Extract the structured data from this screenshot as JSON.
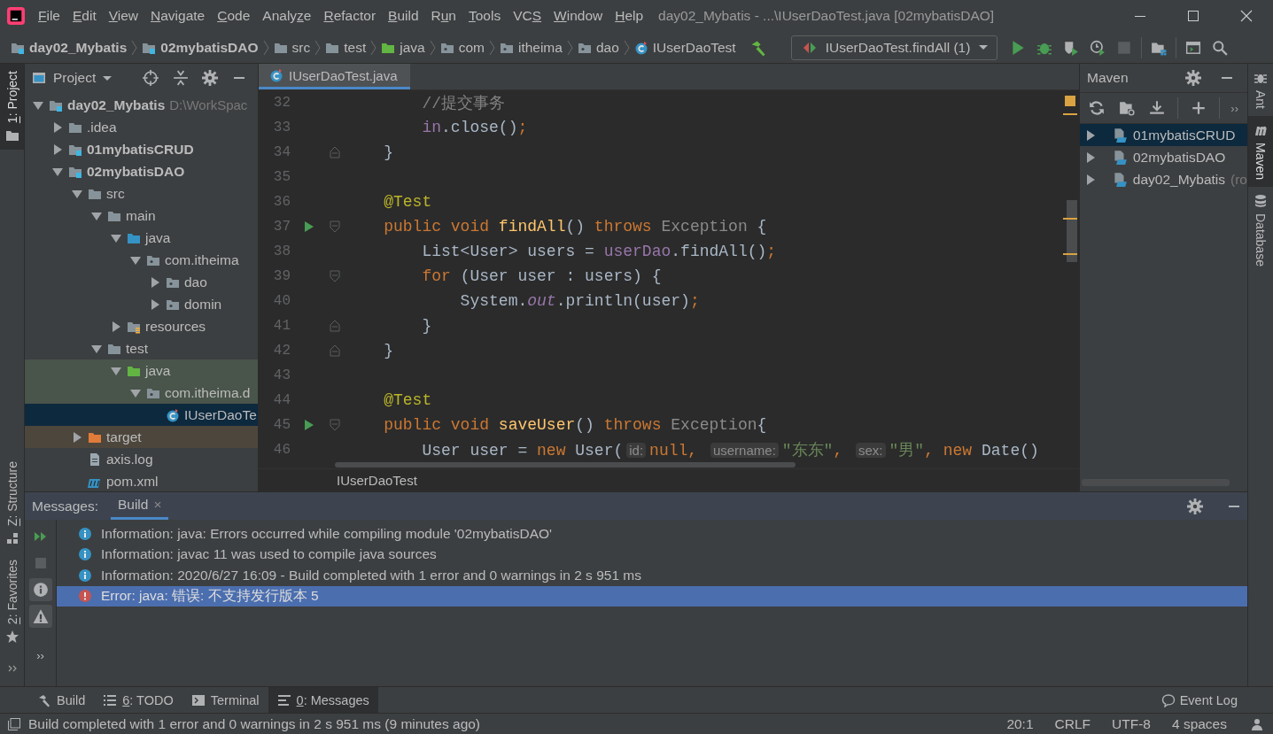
{
  "window": {
    "menus": [
      {
        "key": "F",
        "post": "ile"
      },
      {
        "key": "E",
        "post": "dit"
      },
      {
        "key": "V",
        "post": "iew"
      },
      {
        "key": "N",
        "post": "avigate"
      },
      {
        "key": "C",
        "post": "ode"
      },
      {
        "pre": "Analy",
        "key": "z",
        "post": "e"
      },
      {
        "key": "R",
        "post": "efactor"
      },
      {
        "key": "B",
        "post": "uild"
      },
      {
        "pre": "R",
        "key": "u",
        "post": "n"
      },
      {
        "key": "T",
        "post": "ools"
      },
      {
        "pre": "VC",
        "key": "S"
      },
      {
        "key": "W",
        "post": "indow"
      },
      {
        "key": "H",
        "post": "elp"
      }
    ],
    "title": "day02_Mybatis - ...\\IUserDaoTest.java [02mybatisDAO]"
  },
  "breadcrumbs": [
    {
      "label": "day02_Mybatis",
      "kind": "module",
      "bold": true
    },
    {
      "label": "02mybatisDAO",
      "kind": "module",
      "bold": true
    },
    {
      "label": "src",
      "kind": "folder",
      "bold": false
    },
    {
      "label": "test",
      "kind": "folder",
      "bold": false
    },
    {
      "label": "java",
      "kind": "test-folder",
      "bold": false
    },
    {
      "label": "com",
      "kind": "package",
      "bold": false
    },
    {
      "label": "itheima",
      "kind": "package",
      "bold": false
    },
    {
      "label": "dao",
      "kind": "package",
      "bold": false
    },
    {
      "label": "IUserDaoTest",
      "kind": "class",
      "bold": false
    }
  ],
  "run_config": {
    "label": "IUserDaoTest.findAll (1)"
  },
  "left_stripe": {
    "top": [
      {
        "key": "1",
        "post": ": Project",
        "selected": true
      }
    ],
    "bottom": [
      {
        "key": "Z",
        "post": ": Structure",
        "selected": false
      },
      {
        "key": "2",
        "post": ": Favorites",
        "selected": false
      }
    ]
  },
  "project": {
    "title": "Project",
    "tree": [
      {
        "label": "day02_Mybatis",
        "kind": "module",
        "bold": true,
        "path": "D:\\WorkSpac",
        "expanded": true,
        "selected": false,
        "children": [
          {
            "label": ".idea",
            "kind": "folder",
            "bold": false,
            "expanded": false,
            "selected": false
          },
          {
            "label": "01mybatisCRUD",
            "kind": "module",
            "bold": true,
            "expanded": false,
            "selected": false
          },
          {
            "label": "02mybatisDAO",
            "kind": "module",
            "bold": true,
            "expanded": true,
            "selected": false,
            "children": [
              {
                "label": "src",
                "kind": "folder",
                "bold": false,
                "expanded": true,
                "selected": false,
                "children": [
                  {
                    "label": "main",
                    "kind": "folder",
                    "bold": false,
                    "expanded": true,
                    "selected": false,
                    "children": [
                      {
                        "label": "java",
                        "kind": "source-folder",
                        "bold": false,
                        "expanded": true,
                        "selected": false,
                        "children": [
                          {
                            "label": "com.itheima",
                            "kind": "package",
                            "bold": false,
                            "expanded": true,
                            "selected": false,
                            "children": [
                              {
                                "label": "dao",
                                "kind": "package",
                                "bold": false,
                                "expanded": false,
                                "selected": false
                              },
                              {
                                "label": "domin",
                                "kind": "package",
                                "bold": false,
                                "expanded": false,
                                "selected": false
                              }
                            ]
                          }
                        ]
                      },
                      {
                        "label": "resources",
                        "kind": "resources",
                        "bold": false,
                        "expanded": false,
                        "selected": false
                      }
                    ]
                  },
                  {
                    "label": "test",
                    "kind": "folder",
                    "bold": false,
                    "expanded": true,
                    "selected": false,
                    "children": [
                      {
                        "label": "java",
                        "kind": "test-folder",
                        "bold": false,
                        "expanded": true,
                        "selected": false,
                        "color": "#49544a",
                        "children": [
                          {
                            "label": "com.itheima.d",
                            "kind": "package",
                            "bold": false,
                            "expanded": true,
                            "selected": false,
                            "color": "#49544a",
                            "children": [
                              {
                                "label": "IUserDaoTe",
                                "kind": "class",
                                "bold": false,
                                "selected": true
                              }
                            ]
                          }
                        ]
                      }
                    ]
                  }
                ]
              },
              {
                "label": "target",
                "kind": "excluded",
                "bold": false,
                "expanded": false,
                "selected": false,
                "color": "#4d463c"
              },
              {
                "label": "axis.log",
                "kind": "log",
                "bold": false,
                "selected": false
              },
              {
                "label": "pom.xml",
                "kind": "maven",
                "bold": false,
                "selected": false
              }
            ]
          }
        ]
      }
    ]
  },
  "editor": {
    "tab": {
      "label": "IUserDaoTest.java",
      "selected": true
    },
    "lines": [
      {
        "number": "32",
        "kind": "plain",
        "run": false,
        "tokens": [
          {
            "text": "        //提交事务",
            "kind": "comment"
          }
        ]
      },
      {
        "number": "33",
        "kind": "plain",
        "run": false,
        "tokens": [
          {
            "text": "        in",
            "kind": "field"
          },
          {
            "text": ".close()",
            "kind": "plain"
          },
          {
            "text": ";",
            "kind": "punct"
          }
        ]
      },
      {
        "number": "34",
        "kind": "fold-end",
        "run": false,
        "tokens": [
          {
            "text": "    }",
            "kind": "plain"
          }
        ]
      },
      {
        "number": "35",
        "kind": "plain",
        "run": false
      },
      {
        "number": "36",
        "kind": "plain",
        "run": false,
        "tokens": [
          {
            "text": "    @Test",
            "kind": "annotation"
          }
        ]
      },
      {
        "number": "37",
        "kind": "fold-start",
        "run": true,
        "tokens": [
          {
            "text": "    public void ",
            "kind": "keyword"
          },
          {
            "text": "findAll",
            "kind": "method"
          },
          {
            "text": "() ",
            "kind": "plain"
          },
          {
            "text": "throws ",
            "kind": "keyword"
          },
          {
            "text": "Exception",
            "kind": "type"
          },
          {
            "text": " {",
            "kind": "plain"
          }
        ]
      },
      {
        "number": "38",
        "kind": "plain",
        "run": false,
        "tokens": [
          {
            "text": "        List<User> users = ",
            "kind": "plain"
          },
          {
            "text": "userDao",
            "kind": "field"
          },
          {
            "text": ".findAll()",
            "kind": "plain"
          },
          {
            "text": ";",
            "kind": "punct"
          }
        ]
      },
      {
        "number": "39",
        "kind": "fold-start",
        "run": false,
        "tokens": [
          {
            "text": "        for ",
            "kind": "keyword"
          },
          {
            "text": "(User user : users) {",
            "kind": "plain"
          }
        ]
      },
      {
        "number": "40",
        "kind": "plain",
        "run": false,
        "tokens": [
          {
            "text": "            System.",
            "kind": "plain"
          },
          {
            "text": "out",
            "kind": "static"
          },
          {
            "text": ".println(user)",
            "kind": "plain"
          },
          {
            "text": ";",
            "kind": "punct"
          }
        ]
      },
      {
        "number": "41",
        "kind": "fold-end",
        "run": false,
        "tokens": [
          {
            "text": "        }",
            "kind": "plain"
          }
        ]
      },
      {
        "number": "42",
        "kind": "fold-end",
        "run": false,
        "tokens": [
          {
            "text": "    }",
            "kind": "plain"
          }
        ]
      },
      {
        "number": "43",
        "kind": "plain",
        "run": false
      },
      {
        "number": "44",
        "kind": "plain",
        "run": false,
        "tokens": [
          {
            "text": "    @Test",
            "kind": "annotation"
          }
        ]
      },
      {
        "number": "45",
        "kind": "fold-start",
        "run": true,
        "tokens": [
          {
            "text": "    public void ",
            "kind": "keyword"
          },
          {
            "text": "saveUser",
            "kind": "method"
          },
          {
            "text": "() ",
            "kind": "plain"
          },
          {
            "text": "throws ",
            "kind": "keyword"
          },
          {
            "text": "Exception",
            "kind": "type"
          },
          {
            "text": "{",
            "kind": "plain"
          }
        ]
      },
      {
        "number": "46",
        "kind": "plain",
        "run": false,
        "tokens": [
          {
            "text": "        User user = ",
            "kind": "plain"
          },
          {
            "text": "new",
            "kind": "keyword"
          },
          {
            "text": " User(",
            "kind": "plain"
          },
          {
            "text": "id:",
            "kind": "hint"
          },
          {
            "text": "null",
            "kind": "keyword"
          },
          {
            "text": ", ",
            "kind": "punct"
          },
          {
            "text": "username:",
            "kind": "hint"
          },
          {
            "text": "\"东东\"",
            "kind": "string"
          },
          {
            "text": ", ",
            "kind": "punct"
          },
          {
            "text": "sex:",
            "kind": "hint"
          },
          {
            "text": "\"男\"",
            "kind": "string"
          },
          {
            "text": ", ",
            "kind": "punct"
          },
          {
            "text": "new",
            "kind": "keyword"
          },
          {
            "text": " Date()",
            "kind": "plain"
          }
        ]
      }
    ],
    "breadcrumb": "IUserDaoTest"
  },
  "maven": {
    "title": "Maven",
    "more": "››",
    "items": [
      {
        "label": "01mybatisCRUD",
        "selected": true
      },
      {
        "label": "02mybatisDAO",
        "selected": false
      },
      {
        "label": "day02_Mybatis",
        "note": "(ro",
        "selected": false
      }
    ]
  },
  "right_stripe": [
    {
      "label": "Ant",
      "kind": "ant",
      "selected": false
    },
    {
      "label": "Maven",
      "kind": "maven",
      "selected": true
    },
    {
      "label": "Database",
      "kind": "database",
      "selected": false
    }
  ],
  "messages": {
    "title": "Messages:",
    "tab": {
      "label": "Build",
      "close": "×",
      "selected": true
    },
    "more": "››",
    "items": [
      {
        "kind": "info",
        "text": "Information: java: Errors occurred while compiling module '02mybatisDAO'",
        "selected": false
      },
      {
        "kind": "info",
        "text": "Information: javac 11 was used to compile java sources",
        "selected": false
      },
      {
        "kind": "info",
        "text": "Information: 2020/6/27 16:09 - Build completed with 1 error and 0 warnings in 2 s 951 ms",
        "selected": false
      },
      {
        "kind": "error",
        "text": "Error: java: 错误: 不支持发行版本 5",
        "selected": true
      }
    ]
  },
  "tool_windows": [
    {
      "kind": "build",
      "pre": "Build",
      "selected": false
    },
    {
      "kind": "todo",
      "key": "6",
      "post": ": TODO",
      "selected": false
    },
    {
      "kind": "terminal",
      "pre": "Terminal",
      "selected": false
    },
    {
      "kind": "messages",
      "key": "0",
      "post": ": Messages",
      "selected": true
    }
  ],
  "event_log": "Event Log",
  "status_bar": {
    "text": "Build completed with 1 error and 0 warnings in 2 s 951 ms (9 minutes ago)",
    "items": [
      "20:1",
      "CRLF",
      "UTF-8",
      "4 spaces"
    ]
  }
}
